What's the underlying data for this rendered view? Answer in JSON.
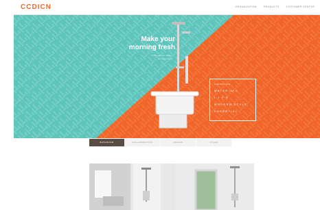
{
  "brand": {
    "logo": "CCDICN"
  },
  "nav": {
    "items": [
      "ORGANIZATION",
      "PRODUCTS",
      "CUSTOMER CENTER"
    ]
  },
  "hero": {
    "headline_line1": "Make your",
    "headline_line2": "morning fresh",
    "sub_line1": "Lorem ipsum dolor",
    "sub_line2": "sit amet elit",
    "badge": {
      "small": "CCDICN LIFE",
      "lines": [
        "MATERIALS",
        "L I F E",
        "MODERN STYLE",
        "ESSENTIAL"
      ]
    },
    "colors": {
      "teal": "#5ec5bd",
      "orange": "#f16628"
    }
  },
  "tabs": {
    "items": [
      "BATHROOM",
      "COLLABORATION",
      "DESIGN",
      "OTHER"
    ],
    "active_index": 0
  },
  "cards": [
    {
      "name": "bathroom-interior"
    },
    {
      "name": "shower-panel"
    }
  ]
}
